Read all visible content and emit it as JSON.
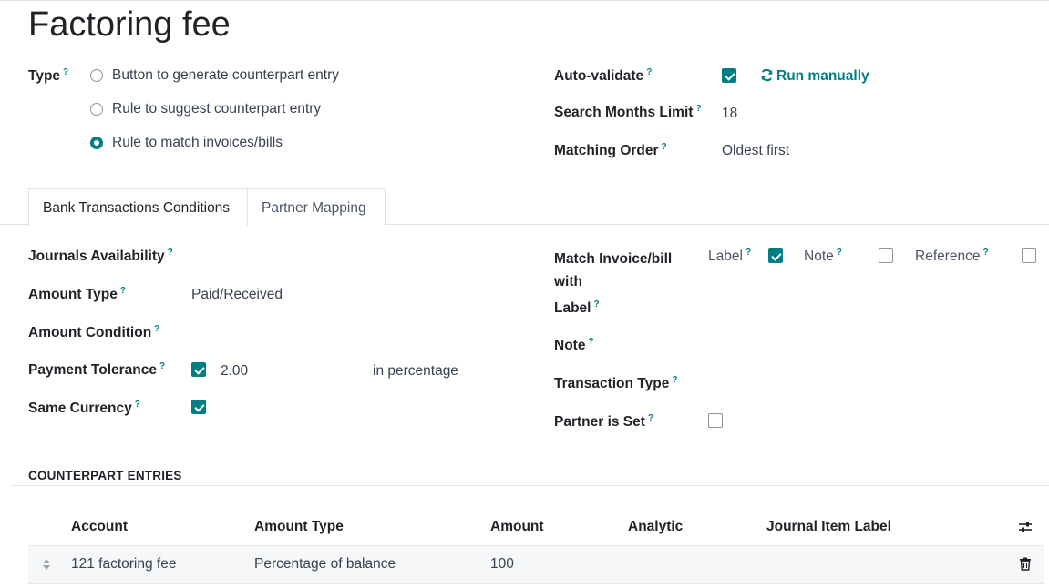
{
  "form": {
    "title": "Factoring fee",
    "type_label": "Type",
    "type_options": [
      {
        "label": "Button to generate counterpart entry",
        "selected": false
      },
      {
        "label": "Rule to suggest counterpart entry",
        "selected": false
      },
      {
        "label": "Rule to match invoices/bills",
        "selected": true
      }
    ],
    "auto_validate_label": "Auto-validate",
    "auto_validate_checked": true,
    "run_manually_label": "Run manually",
    "search_months_label": "Search Months Limit",
    "search_months_value": "18",
    "matching_order_label": "Matching Order",
    "matching_order_value": "Oldest first"
  },
  "tabs": [
    {
      "label": "Bank Transactions Conditions",
      "active": true
    },
    {
      "label": "Partner Mapping",
      "active": false
    }
  ],
  "conditions": {
    "journals_label": "Journals Availability",
    "amount_type_label": "Amount Type",
    "amount_type_value": "Paid/Received",
    "amount_condition_label": "Amount Condition",
    "payment_tolerance_label": "Payment Tolerance",
    "payment_tolerance_checked": true,
    "payment_tolerance_value": "2.00",
    "payment_tolerance_unit": "in percentage",
    "same_currency_label": "Same Currency",
    "same_currency_checked": true,
    "match_with_label_line1": "Match Invoice/bill",
    "match_with_label_line2": "with",
    "match_label_opt": "Label",
    "match_label_checked": true,
    "match_note_opt": "Note",
    "match_note_checked": false,
    "match_reference_opt": "Reference",
    "match_reference_checked": false,
    "label_label": "Label",
    "note_label": "Note",
    "transaction_type_label": "Transaction Type",
    "partner_set_label": "Partner is Set",
    "partner_set_checked": false,
    "help_mark": "?"
  },
  "counterpart": {
    "section_title": "COUNTERPART ENTRIES",
    "columns": [
      "Account",
      "Amount Type",
      "Amount",
      "Analytic",
      "Journal Item Label"
    ],
    "rows": [
      {
        "account": "121 factoring fee",
        "amount_type": "Percentage of balance",
        "amount": "100",
        "analytic": "",
        "label": ""
      }
    ]
  }
}
